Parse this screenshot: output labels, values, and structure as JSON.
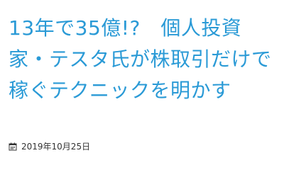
{
  "article": {
    "title": "13年で35億!?　個人投資家・テスタ氏が株取引だけで稼ぐテクニックを明かす",
    "date": "2019年10月25日"
  },
  "icons": {
    "date_icon": "calendar-icon"
  },
  "colors": {
    "title": "#2a9ad6",
    "meta_text": "#333333"
  }
}
